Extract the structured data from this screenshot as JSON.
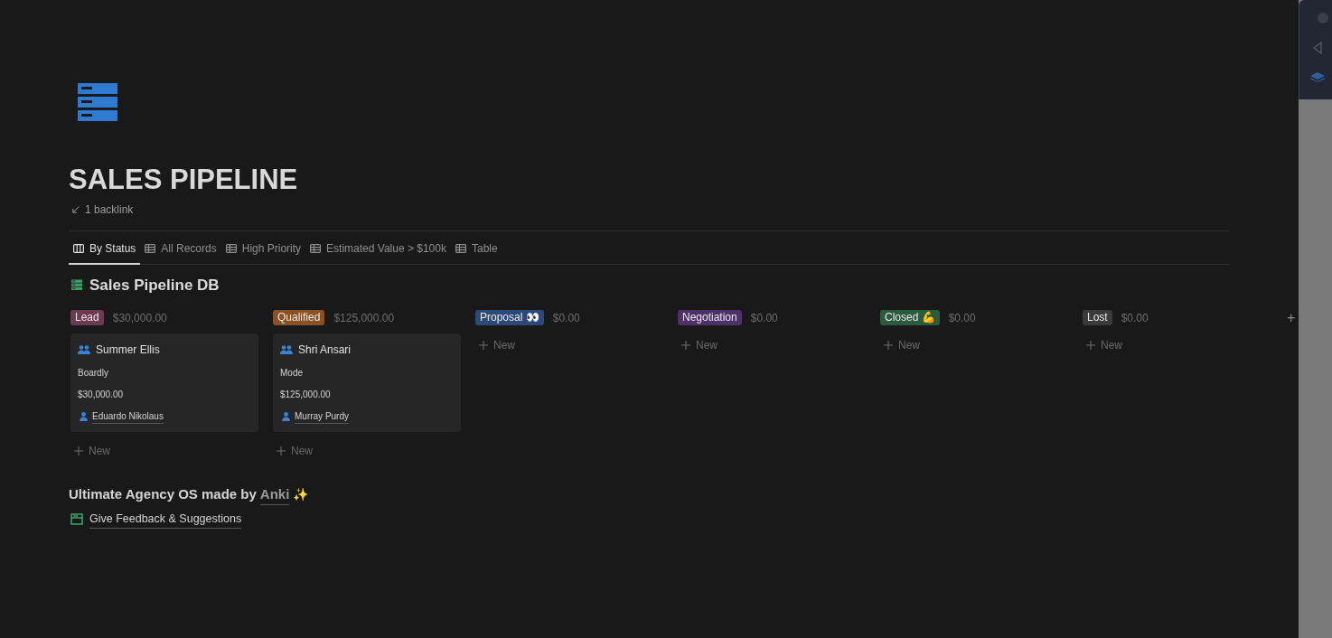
{
  "page": {
    "title": "SALES PIPELINE",
    "backlinks": "1 backlink"
  },
  "tabs": [
    {
      "label": "By Status",
      "kind": "board",
      "selected": true
    },
    {
      "label": "All Records",
      "kind": "table",
      "selected": false
    },
    {
      "label": "High Priority",
      "kind": "table",
      "selected": false
    },
    {
      "label": "Estimated Value > $100k",
      "kind": "table",
      "selected": false
    },
    {
      "label": "Table",
      "kind": "table",
      "selected": false
    }
  ],
  "database": {
    "title": "Sales Pipeline DB"
  },
  "columns": [
    {
      "status": "Lead",
      "color": "#6e3a52",
      "total": "$30,000.00",
      "new": "New",
      "cards": [
        {
          "title": "Summer Ellis",
          "company": "Boardly",
          "value": "$30,000.00",
          "owner": "Eduardo Nikolaus"
        }
      ]
    },
    {
      "status": "Qualified",
      "color": "#8a5224",
      "total": "$125,000.00",
      "new": "New",
      "cards": [
        {
          "title": "Shri Ansari",
          "company": "Mode",
          "value": "$125,000.00",
          "owner": "Murray Purdy"
        }
      ]
    },
    {
      "status": "Proposal 👀",
      "color": "#2c4a78",
      "total": "$0.00",
      "new": "New"
    },
    {
      "status": "Negotiation",
      "color": "#4e3168",
      "total": "$0.00",
      "new": "New"
    },
    {
      "status": "Closed 💪",
      "color": "#2b5a3d",
      "total": "$0.00",
      "new": "New"
    },
    {
      "status": "Lost",
      "color": "#3a3a3a",
      "total": "$0.00",
      "new": "New"
    }
  ],
  "add_column": "+",
  "footer": {
    "heading": "Ultimate Agency OS made by",
    "author": "Anki",
    "emoji": "✨",
    "link": "Give Feedback & Suggestions"
  }
}
